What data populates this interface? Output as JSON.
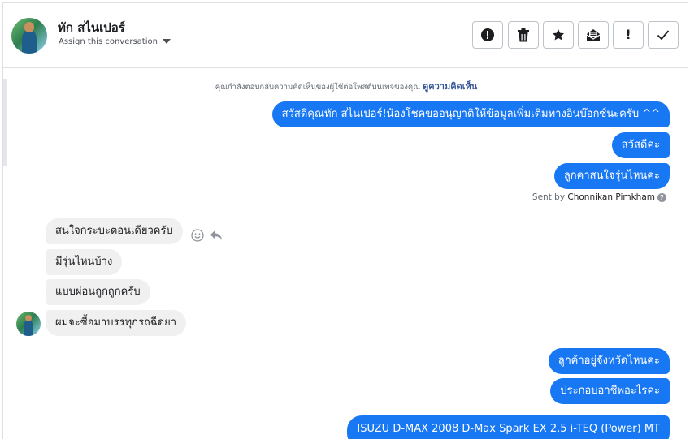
{
  "header": {
    "contact_name": "ทัก สไนเปอร์",
    "assign_label": "Assign this conversation",
    "actions": [
      {
        "name": "mark-spam",
        "icon": "exclamation-circle-icon"
      },
      {
        "name": "delete",
        "icon": "trash-icon"
      },
      {
        "name": "star",
        "icon": "star-icon"
      },
      {
        "name": "mark-unread",
        "icon": "envelope-open-icon"
      },
      {
        "name": "follow-up",
        "icon": "exclamation-icon",
        "glyph": "!"
      },
      {
        "name": "mark-done",
        "icon": "check-icon"
      }
    ]
  },
  "chat": {
    "notice_text": "คุณกำลังตอบกลับความคิดเห็นของผู้ใช้ต่อโพสต์บนเพจของคุณ",
    "notice_link": "ดูความคิดเห็น",
    "outgoing_group1": [
      "สวัสดีคุณทัก สไนเปอร์!น้องโชคขออนุญาติให้ข้อมูลเพิ่มเติมทางอินบ๊อกซ์นะครับ ^^",
      "สวัสดีค่ะ",
      "ลูกคาสนใจรุ่นไหนคะ"
    ],
    "sent_by_prefix": "Sent by",
    "sent_by_name": "Chonnikan Pimkham",
    "sent_by_help": "?",
    "incoming": [
      "สนใจกระบะตอนเดียวครับ",
      "มีรุ่นไหนบ้าง",
      "แบบผ่อนถูกถูกครับ",
      "ผมจะซื้อมาบรรทุกรถฉีดยา"
    ],
    "outgoing_group2": [
      "ลูกค้าอยู่จังหวัดไหนคะ",
      "ประกอบอาชีพอะไรคะ",
      "ISUZU D-MAX 2008 D-Max Spark EX 2.5 i-TEQ (Power) MT"
    ]
  },
  "colors": {
    "accent": "#1877f2",
    "incoming_bubble": "#f0f0f0",
    "link": "#385898"
  }
}
